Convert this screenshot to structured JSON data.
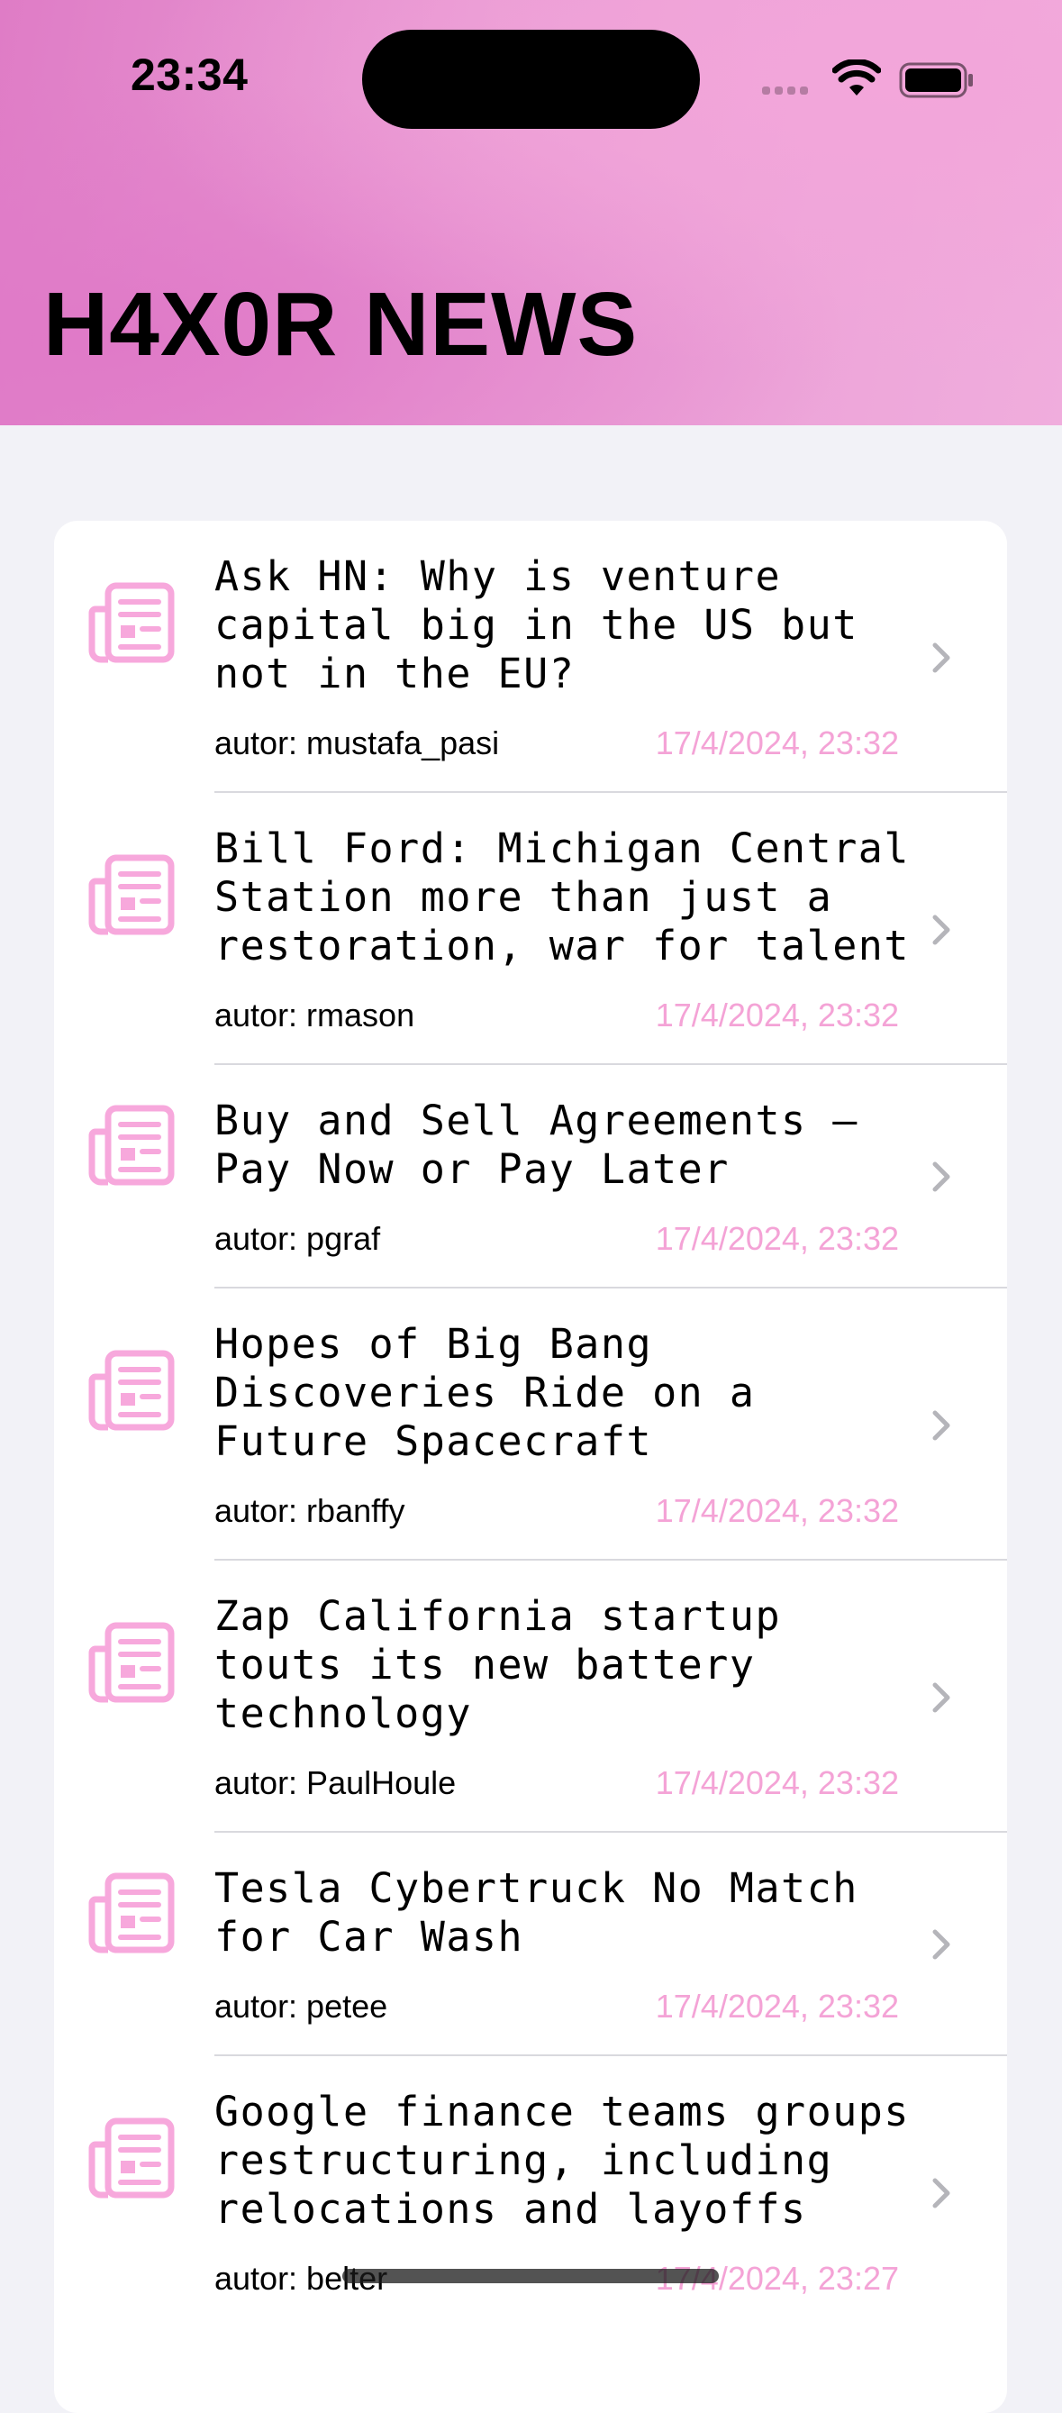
{
  "status_bar": {
    "time": "23:34",
    "icons": [
      "cellular-signal-icon",
      "wifi-icon",
      "battery-icon"
    ]
  },
  "header": {
    "title": "H4X0R NEWS"
  },
  "colors": {
    "accent": "#f4a3d6",
    "icon": "#f7a8dc",
    "header_gradient": [
      "#df7cc6",
      "#f0addd"
    ],
    "background": "#f2f2f7"
  },
  "articles": [
    {
      "title": "Ask HN: Why is venture\ncapital big in the US but\nnot in the EU?",
      "author": "autor: mustafa_pasi",
      "date": "17/4/2024, 23:32",
      "icon": "newspaper-icon"
    },
    {
      "title": "Bill Ford: Michigan Central\nStation more than just a\nrestoration, war for talent",
      "author": "autor: rmason",
      "date": "17/4/2024, 23:32",
      "icon": "newspaper-icon"
    },
    {
      "title": "Buy and Sell Agreements –\nPay Now or Pay Later",
      "author": "autor: pgraf",
      "date": "17/4/2024, 23:32",
      "icon": "newspaper-icon"
    },
    {
      "title": "Hopes of Big Bang\nDiscoveries Ride on a\nFuture Spacecraft",
      "author": "autor: rbanffy",
      "date": "17/4/2024, 23:32",
      "icon": "newspaper-icon"
    },
    {
      "title": "Zap California startup\ntouts its new battery\ntechnology",
      "author": "autor: PaulHoule",
      "date": "17/4/2024, 23:32",
      "icon": "newspaper-icon"
    },
    {
      "title": "Tesla Cybertruck No Match\nfor Car Wash",
      "author": "autor: petee",
      "date": "17/4/2024, 23:32",
      "icon": "newspaper-icon"
    },
    {
      "title": "Google finance teams groups\nrestructuring, including\nrelocations and layoffs",
      "author": "autor: belter",
      "date": "17/4/2024, 23:27",
      "icon": "newspaper-icon"
    }
  ]
}
